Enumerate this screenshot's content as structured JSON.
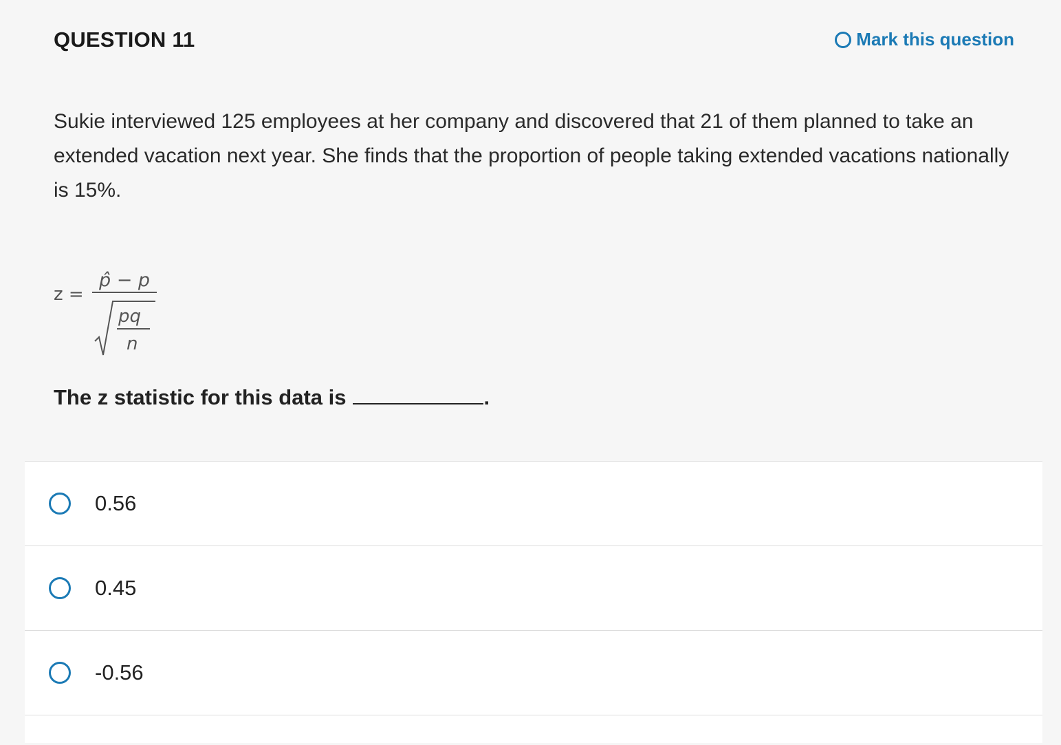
{
  "header": {
    "title": "QUESTION 11",
    "mark_label": "Mark this question"
  },
  "question": {
    "prompt": "Sukie interviewed 125 employees at her company and discovered that 21 of them planned to take an extended vacation next year. She finds that the proportion of people taking extended vacations nationally is 15%.",
    "formula": {
      "lhs": "z =",
      "numerator": "p̂ − p",
      "inner_numerator": "pq",
      "inner_denominator": "n"
    },
    "stem": "The z statistic for this data is",
    "stem_end": "."
  },
  "options": [
    {
      "label": "0.56"
    },
    {
      "label": "0.45"
    },
    {
      "label": "-0.56"
    }
  ],
  "colors": {
    "accent": "#1b7ab5",
    "background": "#f6f6f6",
    "option_bg": "#ffffff",
    "divider": "#dddddd"
  },
  "icons": {
    "mark": "circle-outline-icon",
    "radio": "radio-unchecked-icon"
  }
}
